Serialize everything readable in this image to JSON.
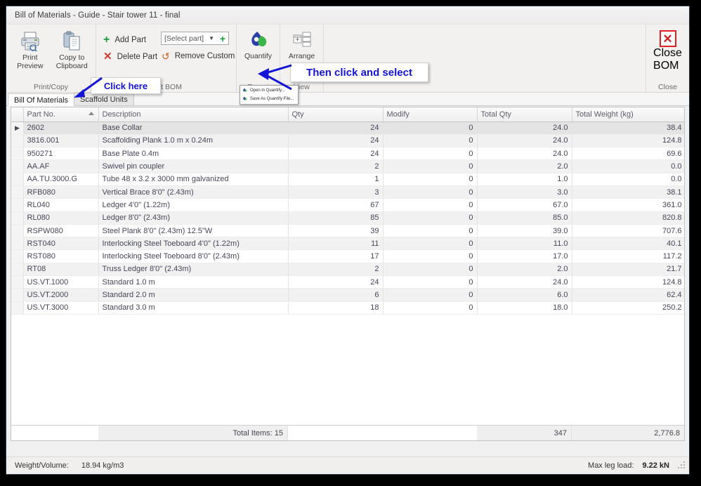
{
  "window": {
    "title": "Bill of Materials - Guide - Stair tower 11 - final"
  },
  "ribbon": {
    "groups": [
      {
        "label": "Print/Copy"
      },
      {
        "label": "Edit BOM"
      },
      {
        "label": "Export"
      },
      {
        "label": "View"
      },
      {
        "label": "Close"
      }
    ],
    "print_preview_label": "Print\nPreview",
    "print_preview_line1": "Print",
    "print_preview_line2": "Preview",
    "copy_clipboard_line1": "Copy to",
    "copy_clipboard_line2": "Clipboard",
    "add_part_label": "Add Part",
    "delete_part_label": "Delete Part",
    "select_part_value": "[Select part]",
    "remove_custom_label": "Remove Custom",
    "quantify_label": "Quantify",
    "arrange_label": "Arrange",
    "close_bom_line1": "Close",
    "close_bom_line2": "BOM",
    "close_x_glyph": "✕"
  },
  "quantify_menu": {
    "items": [
      {
        "label": "Open in Quantify..."
      },
      {
        "label": "Save As Quantify File..."
      }
    ]
  },
  "tabs": [
    {
      "label": "Bill Of Materials",
      "active": true
    },
    {
      "label": "Scaffold Units",
      "active": false
    }
  ],
  "grid": {
    "columns": [
      "Part No.",
      "Description",
      "Qty",
      "Modify",
      "Total Qty",
      "Total Weight (kg)"
    ],
    "sorted_column": "Part No.",
    "sort_direction": "asc",
    "rows": [
      {
        "part": "2602",
        "desc": "Base Collar",
        "qty": "24",
        "modify": "0",
        "total_qty": "24.0",
        "total_weight": "38.4"
      },
      {
        "part": "3816.001",
        "desc": "Scaffolding Plank 1.0 m x 0.24m",
        "qty": "24",
        "modify": "0",
        "total_qty": "24.0",
        "total_weight": "124.8"
      },
      {
        "part": "950271",
        "desc": "Base Plate 0.4m",
        "qty": "24",
        "modify": "0",
        "total_qty": "24.0",
        "total_weight": "69.6"
      },
      {
        "part": "AA.AF",
        "desc": "Swivel pin coupler",
        "qty": "2",
        "modify": "0",
        "total_qty": "2.0",
        "total_weight": "0.0"
      },
      {
        "part": "AA.TU.3000.G",
        "desc": "Tube 48 x 3.2 x 3000 mm galvanized",
        "qty": "1",
        "modify": "0",
        "total_qty": "1.0",
        "total_weight": "0.0"
      },
      {
        "part": "RFB080",
        "desc": "Vertical Brace 8'0\" (2.43m)",
        "qty": "3",
        "modify": "0",
        "total_qty": "3.0",
        "total_weight": "38.1"
      },
      {
        "part": "RL040",
        "desc": "Ledger 4'0\" (1.22m)",
        "qty": "67",
        "modify": "0",
        "total_qty": "67.0",
        "total_weight": "361.0"
      },
      {
        "part": "RL080",
        "desc": "Ledger 8'0\" (2.43m)",
        "qty": "85",
        "modify": "0",
        "total_qty": "85.0",
        "total_weight": "820.8"
      },
      {
        "part": "RSPW080",
        "desc": "Steel Plank 8'0\" (2.43m) 12.5\"W",
        "qty": "39",
        "modify": "0",
        "total_qty": "39.0",
        "total_weight": "707.6"
      },
      {
        "part": "RST040",
        "desc": "Interlocking Steel Toeboard 4'0\" (1.22m)",
        "qty": "11",
        "modify": "0",
        "total_qty": "11.0",
        "total_weight": "40.1"
      },
      {
        "part": "RST080",
        "desc": "Interlocking Steel Toeboard 8'0\" (2.43m)",
        "qty": "17",
        "modify": "0",
        "total_qty": "17.0",
        "total_weight": "117.2"
      },
      {
        "part": "RT08",
        "desc": "Truss Ledger 8'0\" (2.43m)",
        "qty": "2",
        "modify": "0",
        "total_qty": "2.0",
        "total_weight": "21.7"
      },
      {
        "part": "US.VT.1000",
        "desc": "Standard 1.0 m",
        "qty": "24",
        "modify": "0",
        "total_qty": "24.0",
        "total_weight": "124.8"
      },
      {
        "part": "US.VT.2000",
        "desc": "Standard 2.0 m",
        "qty": "6",
        "modify": "0",
        "total_qty": "6.0",
        "total_weight": "62.4"
      },
      {
        "part": "US.VT.3000",
        "desc": "Standard 3.0 m",
        "qty": "18",
        "modify": "0",
        "total_qty": "18.0",
        "total_weight": "250.2"
      }
    ],
    "totals": {
      "items_label": "Total Items: 15",
      "total_qty": "347",
      "total_weight": "2,776.8"
    }
  },
  "status_bar": {
    "left_label": "Weight/Volume:",
    "left_value": "18.94 kg/m3",
    "right_label": "Max leg load:",
    "right_value": "9.22 kN"
  },
  "annotations": [
    {
      "text": "Click here"
    },
    {
      "text": "Then click and select"
    }
  ],
  "colors": {
    "annotation_blue": "#1313d6",
    "close_red": "#e02020",
    "add_green": "#1a9c35",
    "delete_red": "#cf3b2c"
  }
}
